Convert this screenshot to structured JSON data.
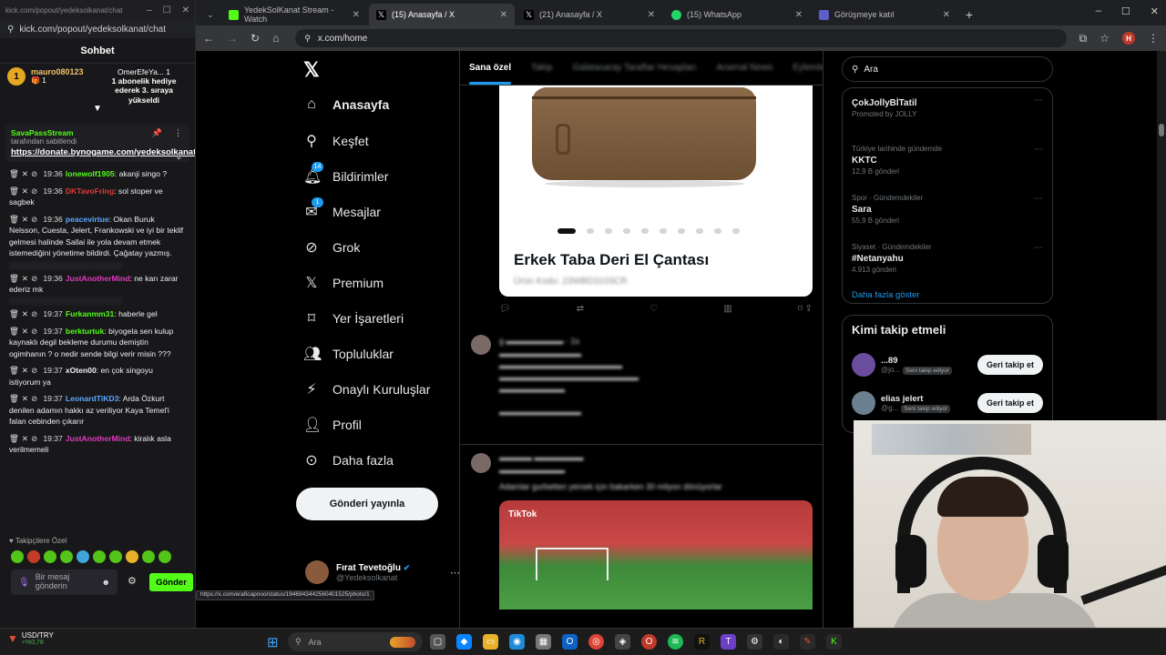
{
  "chat_window": {
    "title": "kick.com/popout/yedeksolkanat/chat",
    "url": "kick.com/popout/yedeksolkanat/chat",
    "header": "Sohbet",
    "leader_rank": "1",
    "leader_name": "mauro080123",
    "leader_count": "1",
    "gift_name": "OmerEfeYa...",
    "gift_rank": "1",
    "gift_text": "1 abonelik hediye ederek 3. sıraya yükseldi",
    "pinned_user": "SavaPassStream",
    "pinned_by": "tarafından sabitlendi",
    "pinned_link": "https://donate.bynogame.com/yedeksolkanat",
    "messages": [
      {
        "time": "19:36",
        "user": "lonewolf1905",
        "color": "#53fc18",
        "text": ": akanji singo ?"
      },
      {
        "time": "19:36",
        "user": "DKTavoFring",
        "color": "#e03a3a",
        "text": ": sol stoper ve sagbek"
      },
      {
        "time": "19:36",
        "user": "peacevirtue",
        "color": "#5aa7ff",
        "text": ": Okan Buruk Nelsson, Cuesta, Jelert, Frankowski ve iyi bir teklif gelmesi halinde Sallai ile yola devam etmek istemediğini yönetime bildirdi. Çağatay yazmış."
      },
      {
        "time": "19:36",
        "user": "JustAnotherMind",
        "color": "#e03abd",
        "text": ": ne karı zarar ederiz mk"
      },
      {
        "time": "19:37",
        "user": "Furkanmm31",
        "color": "#53fc18",
        "text": ": haberle gel"
      },
      {
        "time": "19:37",
        "user": "berkturtuk",
        "color": "#53fc18",
        "text": ": biyogela sen kulup kaynaklı degil bekleme durumu demiştin ogimhanın ? o nedir sende bilgi verir misin ???"
      },
      {
        "time": "19:37",
        "user": "xOten00",
        "color": "#efeff1",
        "text": ": en çok singoyu istiyorum ya"
      },
      {
        "time": "19:37",
        "user": "LeonardTiKD3",
        "color": "#5aa7ff",
        "text": ": Arda Özkurt denilen adamın hakkı az veriliyor Kaya Temel'i falan cebinden çıkarır"
      },
      {
        "time": "19:37",
        "user": "JustAnotherMind",
        "color": "#e03abd",
        "text": ": kiralık asla verilmemeli"
      }
    ],
    "followers_label": "Takipçilere Özel",
    "input_placeholder": "Bir mesaj gönderin",
    "send_label": "Gönder"
  },
  "browser": {
    "tabs": [
      {
        "label": "YedekSolKanat Stream - Watch",
        "color": "#53fc18"
      },
      {
        "label": "(15) Anasayfa / X",
        "color": "#ffffff"
      },
      {
        "label": "(21) Anasayfa / X",
        "color": "#ffffff"
      },
      {
        "label": "(15) WhatsApp",
        "color": "#25d366"
      },
      {
        "label": "Görüşmeye katıl",
        "color": "#5b5fc7"
      }
    ],
    "url": "x.com/home",
    "profile_initial": "H"
  },
  "x": {
    "nav": [
      {
        "label": "Anasayfa",
        "icon": "home-icon"
      },
      {
        "label": "Keşfet",
        "icon": "search-icon"
      },
      {
        "label": "Bildirimler",
        "icon": "bell-icon",
        "badge": "14"
      },
      {
        "label": "Mesajlar",
        "icon": "mail-icon",
        "badge": "1"
      },
      {
        "label": "Grok",
        "icon": "grok-icon"
      },
      {
        "label": "Premium",
        "icon": "x-icon"
      },
      {
        "label": "Yer İşaretleri",
        "icon": "bookmark-icon"
      },
      {
        "label": "Topluluklar",
        "icon": "people-icon"
      },
      {
        "label": "Onaylı Kuruluşlar",
        "icon": "bolt-icon"
      },
      {
        "label": "Profil",
        "icon": "user-icon"
      },
      {
        "label": "Daha fazla",
        "icon": "more-icon"
      }
    ],
    "post_button": "Gönderi yayınla",
    "account_name": "Fırat Tevetoğlu",
    "account_handle": "@Yedeksolkanat",
    "feed_tabs": [
      "Sana özel",
      "Takip",
      "Galatasaray Taraftar Hesapları",
      "Arsenal News",
      "Eylemler"
    ],
    "product_title": "Erkek Taba Deri El Çantası",
    "product_code": "Ürün Kodu: 23WBD3103CR",
    "tweet2_text": "Adamlar gurbetten yemek için bakarken 30 milyon dönüyorlar",
    "video_label": "TikTok",
    "search_placeholder": "Ara",
    "trends": [
      {
        "ctx": "Promoted by JOLLY",
        "name": "ÇokJollyBİTatil",
        "count": ""
      },
      {
        "ctx": "Türkiye tarihinde gündemde",
        "name": "KKTC",
        "count": "12,9 B gönderi"
      },
      {
        "ctx": "Spor · Gündemdekiler",
        "name": "Sara",
        "count": "55,9 B gönderi"
      },
      {
        "ctx": "Siyaset · Gündemdekiler",
        "name": "#Netanyahu",
        "count": "4.913 gönderi"
      }
    ],
    "show_more": "Daha fazla göster",
    "who_to_follow": "Kimi takip etmeli",
    "follow_suggestions": [
      {
        "name": "...89",
        "handle": "@jo...",
        "chip": "Seni takip ediyor",
        "button": "Geri takip et"
      },
      {
        "name": "elias jelert",
        "handle": "@g...",
        "chip": "Seni takip ediyor",
        "button": "Geri takip et"
      }
    ]
  },
  "status_url": "https://x.com/eraficapnoo/status/1946943442560401525/photo/1",
  "taskbar": {
    "ticker_symbol": "USD/TRY",
    "ticker_change": "+%0,78",
    "search_placeholder": "Ara"
  }
}
